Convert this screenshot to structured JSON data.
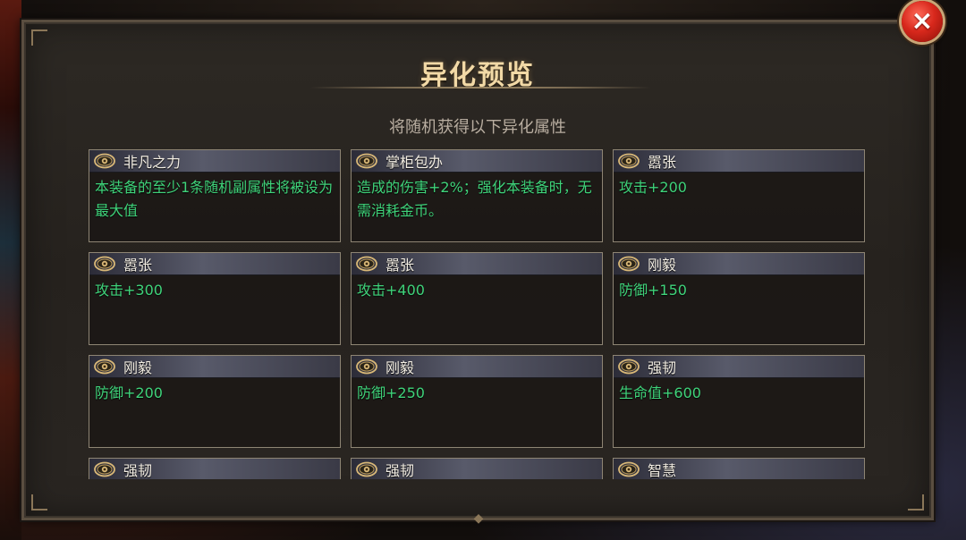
{
  "dialog": {
    "title": "异化预览",
    "subtitle": "将随机获得以下异化属性",
    "close_icon": "×"
  },
  "cards": [
    {
      "name": "非凡之力",
      "desc": "本装备的至少1条随机副属性将被设为最大值"
    },
    {
      "name": "掌柜包办",
      "desc": "造成的伤害+2%；强化本装备时，无需消耗金币。"
    },
    {
      "name": "嚣张",
      "desc": "攻击+200"
    },
    {
      "name": "嚣张",
      "desc": "攻击+300"
    },
    {
      "name": "嚣张",
      "desc": "攻击+400"
    },
    {
      "name": "刚毅",
      "desc": "防御+150"
    },
    {
      "name": "刚毅",
      "desc": "防御+200"
    },
    {
      "name": "刚毅",
      "desc": "防御+250"
    },
    {
      "name": "强韧",
      "desc": "生命值+600"
    },
    {
      "name": "强韧",
      "desc": ""
    },
    {
      "name": "强韧",
      "desc": ""
    },
    {
      "name": "智慧",
      "desc": ""
    }
  ],
  "colors": {
    "title": "#f2d9a6",
    "subtitle": "#b8ada0",
    "attribute_text": "#3fd37a",
    "eye_icon": "#d9b877",
    "close_button": "#d8281c"
  }
}
